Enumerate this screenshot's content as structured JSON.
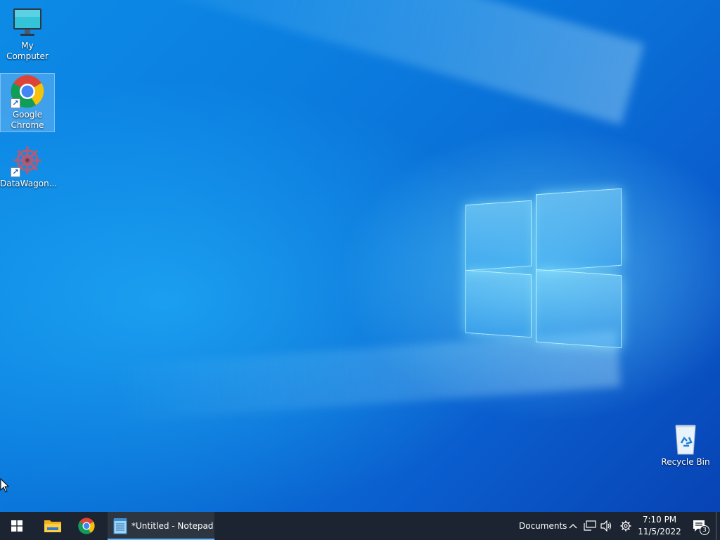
{
  "desktop": {
    "icons": [
      {
        "label": "My Computer",
        "icon": "monitor-icon"
      },
      {
        "label": "Google Chrome",
        "icon": "chrome-icon",
        "shortcut": true,
        "selected": true
      },
      {
        "label": "DataWagon...",
        "icon": "datawagon-icon",
        "shortcut": true
      },
      {
        "label": "Recycle Bin",
        "icon": "recycle-bin-icon"
      }
    ]
  },
  "taskbar": {
    "start": {
      "icon": "windows-logo-icon"
    },
    "pinned": [
      {
        "name": "File Explorer",
        "icon": "folder-icon"
      },
      {
        "name": "Google Chrome",
        "icon": "chrome-icon"
      }
    ],
    "running_window": {
      "title": "*Untitled - Notepad",
      "icon": "notepad-icon"
    },
    "tray": {
      "toolbar_label": "Documents",
      "icons": [
        "chevron-up-icon",
        "network-icon",
        "volume-icon",
        "gear-icon"
      ],
      "time": "7:10 PM",
      "date": "11/5/2022",
      "notification_count": "3"
    }
  },
  "colors": {
    "taskbar": "#1b2430",
    "accent": "#63b6ff",
    "wallpaper": "#0a6ed6"
  }
}
